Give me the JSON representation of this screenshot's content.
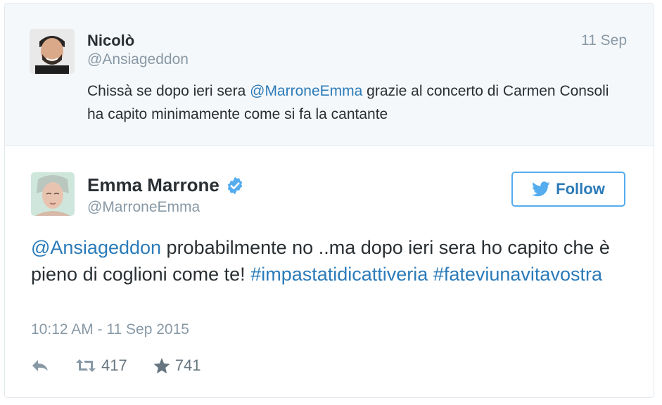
{
  "quoted_tweet": {
    "author_name": "Nicolò",
    "author_handle": "@Ansiageddon",
    "date": "11 Sep",
    "text_before": "Chissà se dopo ieri sera ",
    "mention": "@MarroneEmma",
    "text_after": " grazie al concerto di Carmen Consoli ha capito minimamente come si fa la cantante"
  },
  "main_tweet": {
    "author_name": "Emma Marrone",
    "author_handle": "@MarroneEmma",
    "verified": true,
    "follow_label": "Follow",
    "mention": "@Ansiageddon",
    "text_body": " probabilmente no ..ma dopo ieri sera ho capito che è pieno di coglioni come te! ",
    "hashtag_1": "#impastatidicattiveria",
    "hashtag_2": "#fateviunavitavostra",
    "timestamp": "10:12 AM - 11 Sep 2015",
    "actions": {
      "reply_icon": "reply-icon",
      "retweet_icon": "retweet-icon",
      "retweet_count": "417",
      "favorite_icon": "star-icon",
      "favorite_count": "741"
    }
  },
  "colors": {
    "link": "#2b7bb9",
    "muted": "#8899a6",
    "text": "#292f33",
    "quoted_bg": "#f5f8fa",
    "follow_border": "#55acee",
    "verified": "#55acee"
  }
}
